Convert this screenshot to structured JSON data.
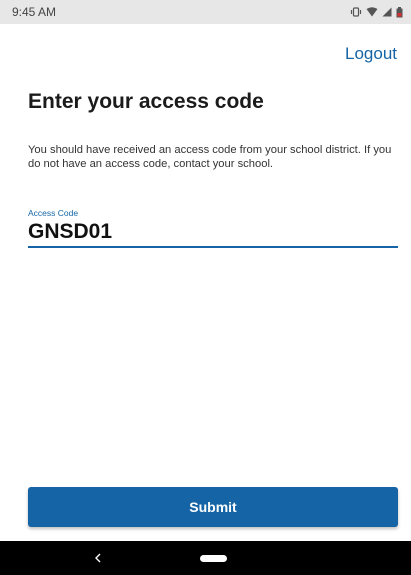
{
  "status_bar": {
    "time": "9:45 AM",
    "icons": [
      "vibrate-icon",
      "wifi-icon",
      "signal-icon",
      "battery-icon"
    ],
    "battery_color": "#d32f2f"
  },
  "header": {
    "logout_label": "Logout"
  },
  "main": {
    "title": "Enter your access code",
    "description": "You should have received an access code from your school district. If you do not have an access code, contact your school.",
    "access_code": {
      "label": "Access Code",
      "value": "GNSD01"
    },
    "submit_label": "Submit"
  },
  "nav_bar": {
    "icons": [
      "back-icon",
      "home-icon"
    ]
  },
  "colors": {
    "accent": "#1565a6",
    "status_bar_bg": "#e7e7e7",
    "nav_bar_bg": "#000000"
  }
}
